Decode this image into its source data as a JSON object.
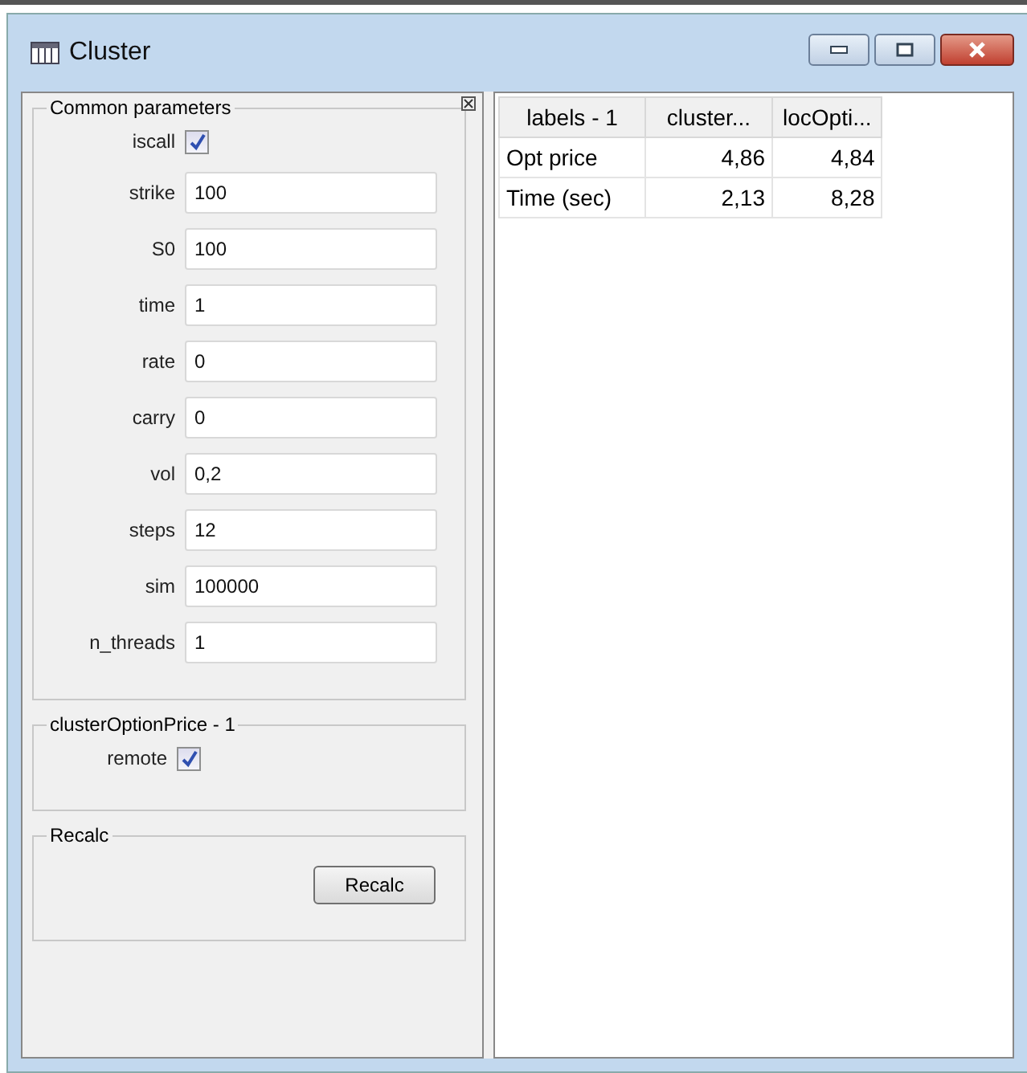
{
  "window": {
    "title": "Cluster"
  },
  "groups": [
    {
      "title": "Common parameters",
      "params": [
        {
          "kind": "checkbox",
          "label": "iscall",
          "checked": true
        },
        {
          "kind": "field",
          "label": "strike",
          "value": "100"
        },
        {
          "kind": "field",
          "label": "S0",
          "value": "100"
        },
        {
          "kind": "field",
          "label": "time",
          "value": "1"
        },
        {
          "kind": "field",
          "label": "rate",
          "value": "0"
        },
        {
          "kind": "field",
          "label": "carry",
          "value": "0"
        },
        {
          "kind": "field",
          "label": "vol",
          "value": "0,2"
        },
        {
          "kind": "field",
          "label": "steps",
          "value": "12"
        },
        {
          "kind": "field",
          "label": "sim",
          "value": "100000"
        },
        {
          "kind": "field",
          "label": "n_threads",
          "value": "1"
        }
      ]
    },
    {
      "title": "clusterOptionPrice - 1",
      "params": [
        {
          "kind": "checkbox",
          "label": "remote",
          "checked": true
        }
      ]
    },
    {
      "title": "Recalc",
      "params": [
        {
          "kind": "button",
          "label": "Recalc"
        }
      ]
    }
  ],
  "table": {
    "columns": [
      "labels - 1",
      "cluster...",
      "locOpti..."
    ],
    "rows": [
      [
        "Opt price",
        "4,86",
        "4,84"
      ],
      [
        "Time (sec)",
        "2,13",
        "8,28"
      ]
    ]
  }
}
